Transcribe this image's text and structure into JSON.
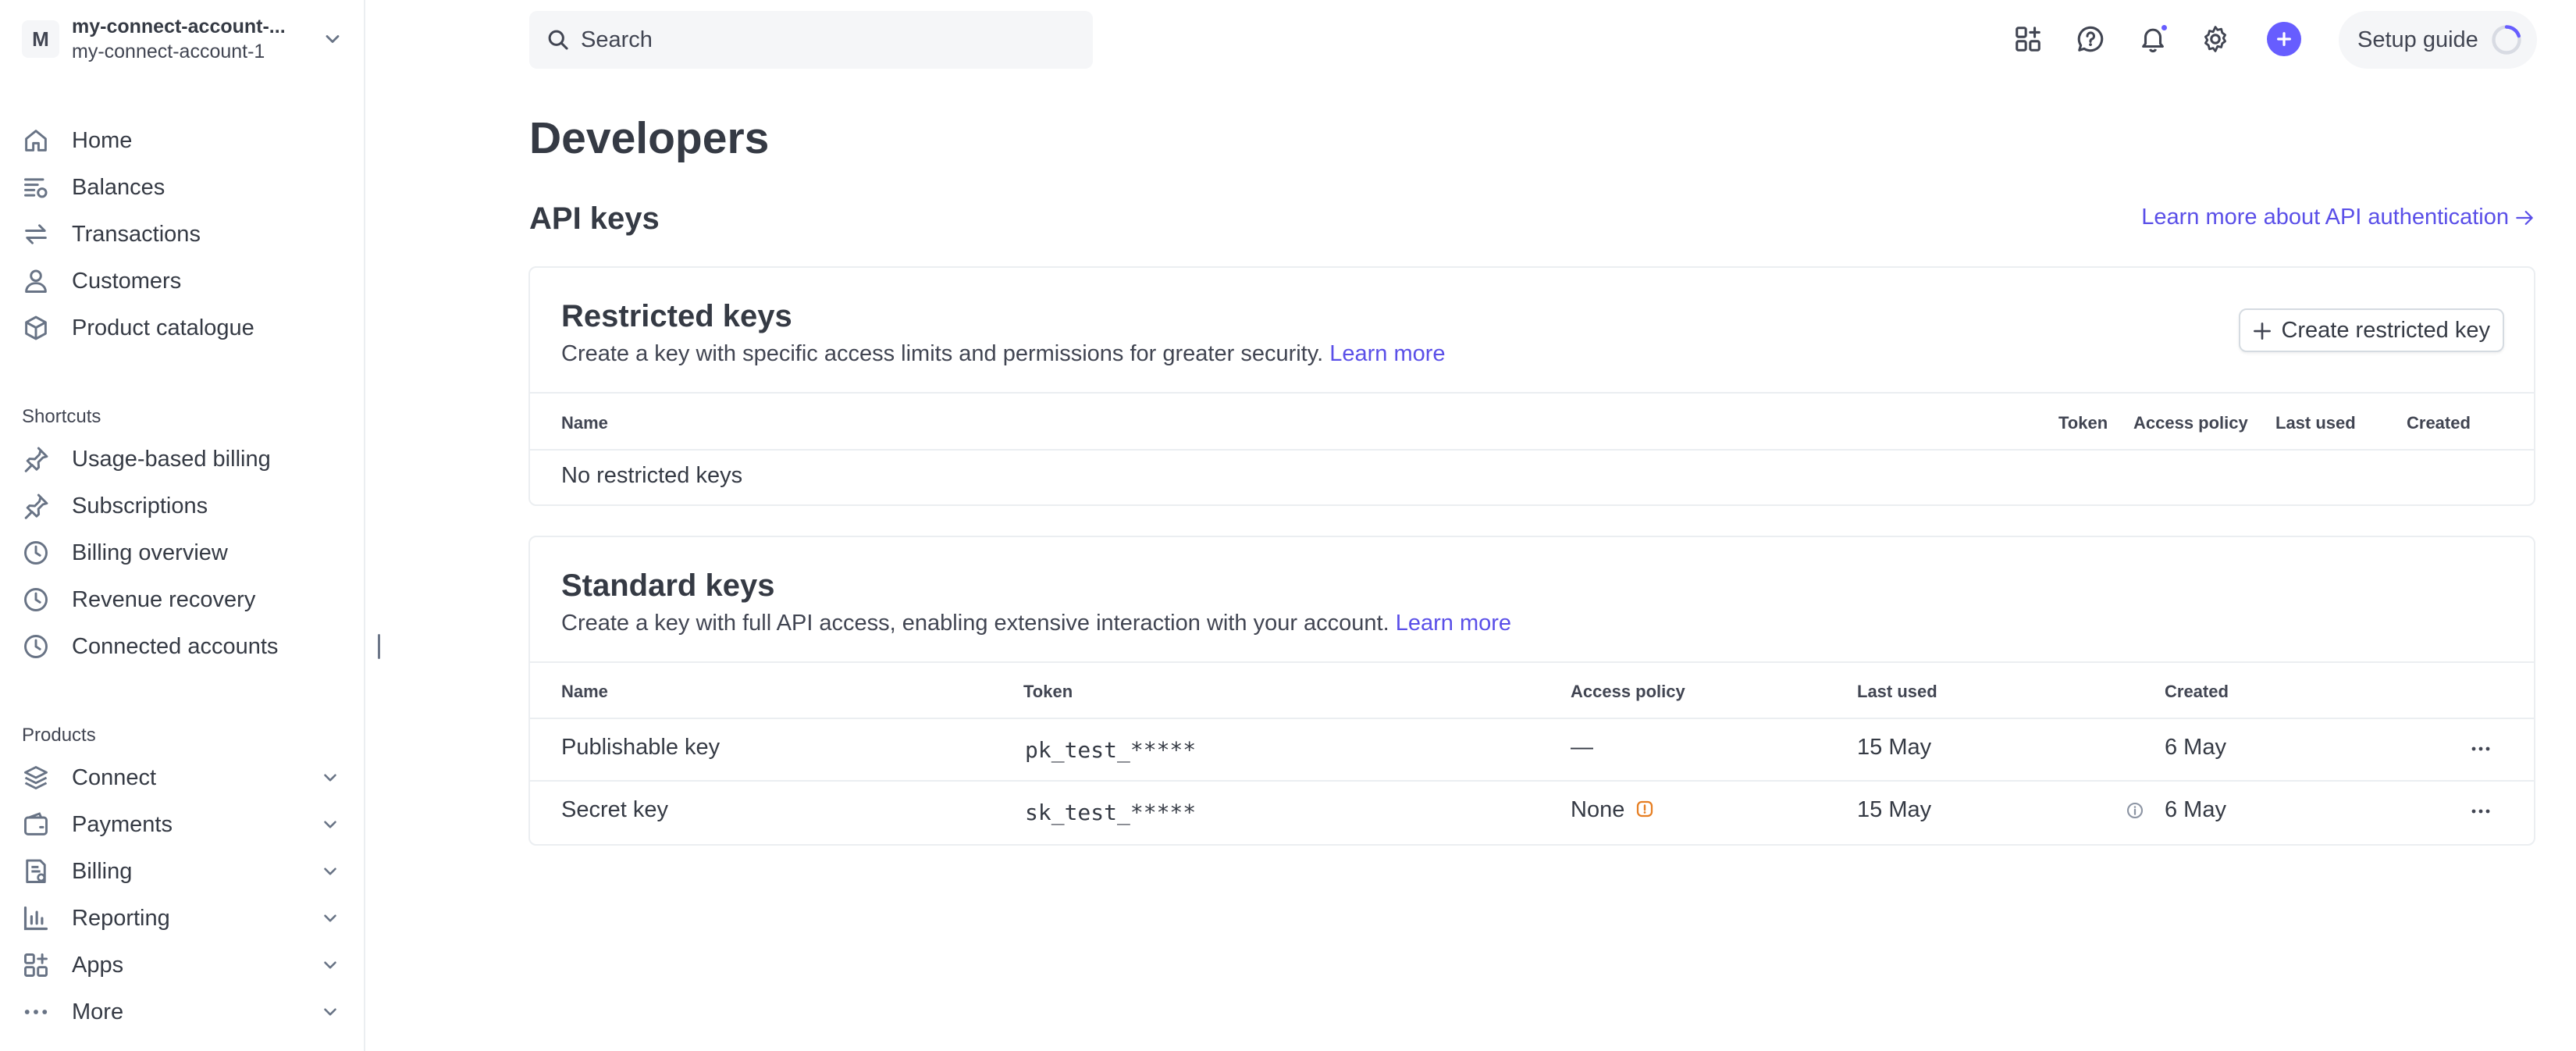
{
  "account": {
    "initial": "M",
    "name": "my-connect-account-...",
    "sub": "my-connect-account-1"
  },
  "sidebar": {
    "main_items": [
      {
        "label": "Home",
        "icon": "home-icon"
      },
      {
        "label": "Balances",
        "icon": "balances-icon"
      },
      {
        "label": "Transactions",
        "icon": "transactions-icon"
      },
      {
        "label": "Customers",
        "icon": "customers-icon"
      },
      {
        "label": "Product catalogue",
        "icon": "product-icon"
      }
    ],
    "shortcuts_title": "Shortcuts",
    "shortcuts": [
      {
        "label": "Usage-based billing",
        "icon": "pin-icon"
      },
      {
        "label": "Subscriptions",
        "icon": "pin-icon"
      },
      {
        "label": "Billing overview",
        "icon": "clock-icon"
      },
      {
        "label": "Revenue recovery",
        "icon": "clock-icon"
      },
      {
        "label": "Connected accounts",
        "icon": "clock-icon"
      }
    ],
    "products_title": "Products",
    "products": [
      {
        "label": "Connect",
        "icon": "connect-icon"
      },
      {
        "label": "Payments",
        "icon": "payments-icon"
      },
      {
        "label": "Billing",
        "icon": "billing-icon"
      },
      {
        "label": "Reporting",
        "icon": "reporting-icon"
      },
      {
        "label": "Apps",
        "icon": "apps-icon"
      },
      {
        "label": "More",
        "icon": "more-icon"
      }
    ]
  },
  "topbar": {
    "search_placeholder": "Search",
    "setup_guide": "Setup guide",
    "accent": "#675dff"
  },
  "page": {
    "title": "Developers",
    "section_title": "API keys",
    "learn_more_auth": "Learn more about API authentication"
  },
  "restricted": {
    "title": "Restricted keys",
    "desc": "Create a key with specific access limits and permissions for greater security.",
    "learn_more": "Learn more",
    "create_button": "Create restricted key",
    "columns": {
      "name": "Name",
      "token": "Token",
      "access_policy": "Access policy",
      "last_used": "Last used",
      "created": "Created"
    },
    "empty_text": "No restricted keys"
  },
  "standard": {
    "title": "Standard keys",
    "desc": "Create a key with full API access, enabling extensive interaction with your account.",
    "learn_more": "Learn more",
    "columns": {
      "name": "Name",
      "token": "Token",
      "access_policy": "Access policy",
      "last_used": "Last used",
      "created": "Created"
    },
    "rows": [
      {
        "name": "Publishable key",
        "token": "pk_test_*****",
        "access_policy": "—",
        "last_used": "15 May",
        "created": "6 May"
      },
      {
        "name": "Secret key",
        "token": "sk_test_*****",
        "access_policy": "None",
        "last_used": "15 May",
        "created": "6 May"
      }
    ]
  }
}
